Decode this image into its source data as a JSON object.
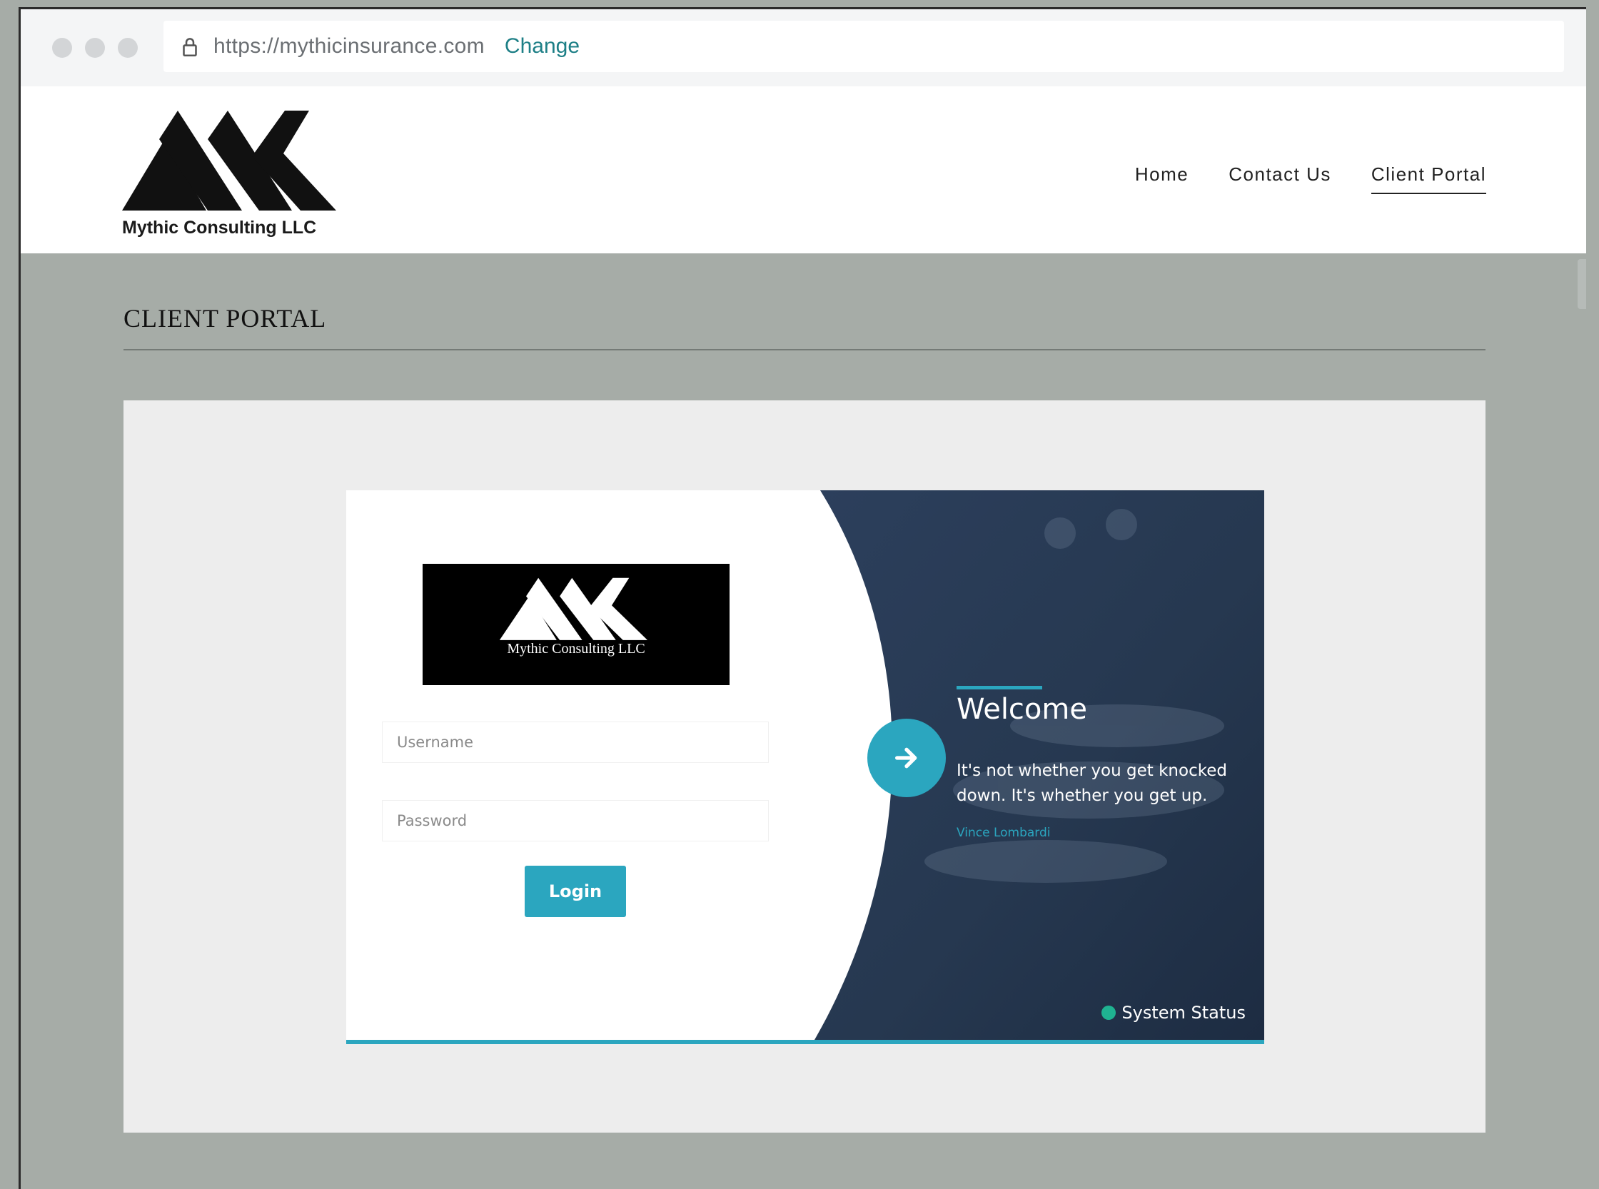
{
  "browser": {
    "url": "https://mythicinsurance.com",
    "change_label": "Change"
  },
  "site": {
    "brand_name": "Mythic Consulting LLC",
    "nav": [
      {
        "label": "Home"
      },
      {
        "label": "Contact Us"
      },
      {
        "label": "Client Portal",
        "active": true
      }
    ]
  },
  "page": {
    "title": "CLIENT PORTAL"
  },
  "login_card": {
    "logo_text": "Mythic Consulting LLC",
    "username_placeholder": "Username",
    "password_placeholder": "Password",
    "login_label": "Login",
    "welcome_title": "Welcome",
    "quote": "It's not whether you get knocked down. It's whether you get up.",
    "quote_author": "Vince Lombardi",
    "status_label": "System Status",
    "status_color": "#1fb391",
    "accent_color": "#2ba6bf"
  }
}
